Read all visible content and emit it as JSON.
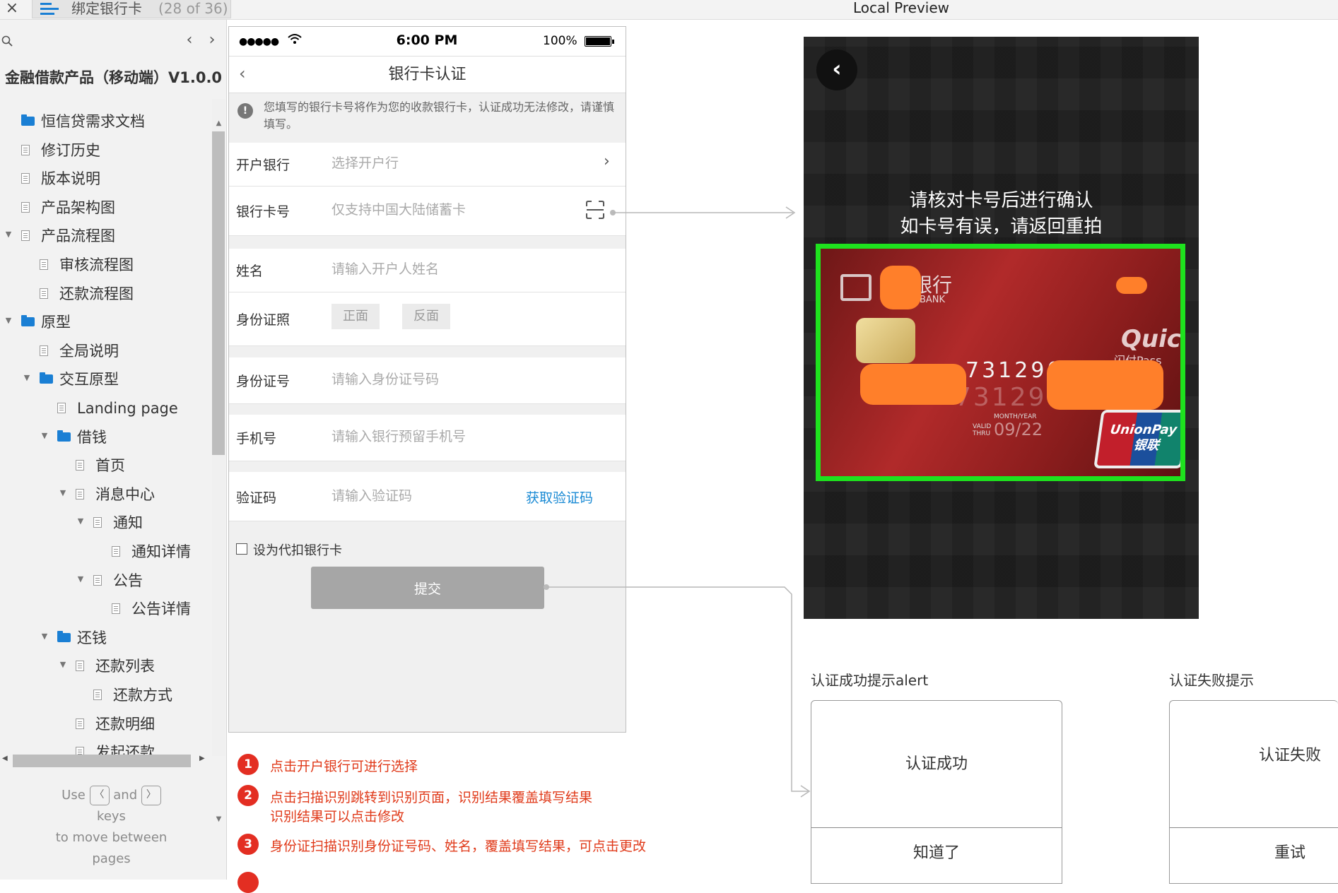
{
  "topbar": {
    "close_glyph": "×",
    "page_title": "绑定银行卡",
    "page_count": "(28 of 36)",
    "preview_title": "Local Preview"
  },
  "sidebar": {
    "prev_glyph": "‹",
    "next_glyph": "›",
    "project_title": "金融借款产品（移动端）V1.0.0",
    "items": [
      {
        "label": "恒信贷需求文档",
        "type": "folder",
        "level": 1,
        "toggle": ""
      },
      {
        "label": "修订历史",
        "type": "page",
        "level": 1,
        "toggle": ""
      },
      {
        "label": "版本说明",
        "type": "page",
        "level": 1,
        "toggle": ""
      },
      {
        "label": "产品架构图",
        "type": "page",
        "level": 1,
        "toggle": ""
      },
      {
        "label": "产品流程图",
        "type": "page",
        "level": 1,
        "toggle": "▼"
      },
      {
        "label": "审核流程图",
        "type": "page",
        "level": 2,
        "toggle": ""
      },
      {
        "label": "还款流程图",
        "type": "page",
        "level": 2,
        "toggle": ""
      },
      {
        "label": "原型",
        "type": "folder",
        "level": 1,
        "toggle": "▼"
      },
      {
        "label": "全局说明",
        "type": "page",
        "level": 2,
        "toggle": ""
      },
      {
        "label": "交互原型",
        "type": "folder",
        "level": 2,
        "toggle": "▼"
      },
      {
        "label": "Landing page",
        "type": "page",
        "level": 3,
        "toggle": ""
      },
      {
        "label": "借钱",
        "type": "folder",
        "level": 3,
        "toggle": "▼"
      },
      {
        "label": "首页",
        "type": "page",
        "level": 4,
        "toggle": ""
      },
      {
        "label": "消息中心",
        "type": "page",
        "level": 4,
        "toggle": "▼"
      },
      {
        "label": "通知",
        "type": "page",
        "level": 5,
        "toggle": "▼"
      },
      {
        "label": "通知详情",
        "type": "page",
        "level": 6,
        "toggle": ""
      },
      {
        "label": "公告",
        "type": "page",
        "level": 5,
        "toggle": "▼"
      },
      {
        "label": "公告详情",
        "type": "page",
        "level": 6,
        "toggle": ""
      },
      {
        "label": "还钱",
        "type": "folder",
        "level": 3,
        "toggle": "▼"
      },
      {
        "label": "还款列表",
        "type": "page",
        "level": 4,
        "toggle": "▼"
      },
      {
        "label": "还款方式",
        "type": "page",
        "level": 5,
        "toggle": ""
      },
      {
        "label": "还款明细",
        "type": "page",
        "level": 4,
        "toggle": ""
      },
      {
        "label": "发起还款",
        "type": "page",
        "level": 4,
        "toggle": ""
      }
    ],
    "hint": {
      "use": "Use",
      "key_prev": "〈",
      "and": "and",
      "key_next": "〉",
      "keys": "keys",
      "rest": "to move between pages"
    }
  },
  "phone": {
    "signal": "●●●●●",
    "time": "6:00 PM",
    "battery_pct": "100%",
    "nav_back": "‹",
    "title": "银行卡认证",
    "notice_icon": "!",
    "notice": "您填写的银行卡号将作为您的收款银行卡，认证成功无法修改，请谨慎填写。",
    "bank": {
      "label": "开户银行",
      "placeholder": "选择开户行",
      "chevron": "›"
    },
    "card_no": {
      "label": "银行卡号",
      "placeholder": "仅支持中国大陆储蓄卡"
    },
    "name": {
      "label": "姓名",
      "placeholder": "请输入开户人姓名"
    },
    "id_photo": {
      "label": "身份证照",
      "front": "正面",
      "back": "反面"
    },
    "id_no": {
      "label": "身份证号",
      "placeholder": "请输入身份证号码"
    },
    "phone_no": {
      "label": "手机号",
      "placeholder": "请输入银行预留手机号"
    },
    "code": {
      "label": "验证码",
      "placeholder": "请输入验证码",
      "get_code": "获取验证码"
    },
    "checkbox_label": "设为代扣银行卡",
    "submit": "提交"
  },
  "annotations": [
    {
      "num": "1",
      "text": "点击开户银行可进行选择"
    },
    {
      "num": "2",
      "text": "点击扫描识别跳转到识别页面，识别结果覆盖填写结果",
      "text2": "识别结果可以点击修改"
    },
    {
      "num": "3",
      "text": "身份证扫描识别身份证号码、姓名，覆盖填写结果，可点击更改"
    }
  ],
  "camera": {
    "back_glyph": "‹",
    "tip_line1": "请核对卡号后进行确认",
    "tip_line2": "如卡号有误，请返回重拍",
    "card": {
      "bank_name": "银行",
      "bank_en": "BANK",
      "quick": "Quick",
      "pass": "闪付Pass",
      "number": "731290",
      "number_emboss": "73129",
      "month_year": "MONTH/YEAR",
      "valid_thru": "VALID THRU",
      "expiry": "09/22",
      "unionpay": "UnionPay",
      "unionpay_cn": "银联"
    }
  },
  "alerts": {
    "success": {
      "section": "认证成功提示alert",
      "message": "认证成功",
      "button": "知道了"
    },
    "failure": {
      "section": "认证失败提示",
      "message": "认证失败",
      "button": "重试"
    }
  },
  "colors": {
    "accent_blue": "#1a7fd4",
    "annotation_red": "#e32e22",
    "link_blue": "#1a8ad4",
    "frame_green": "#1ee21e",
    "submit_grey": "#a6a6a6"
  }
}
